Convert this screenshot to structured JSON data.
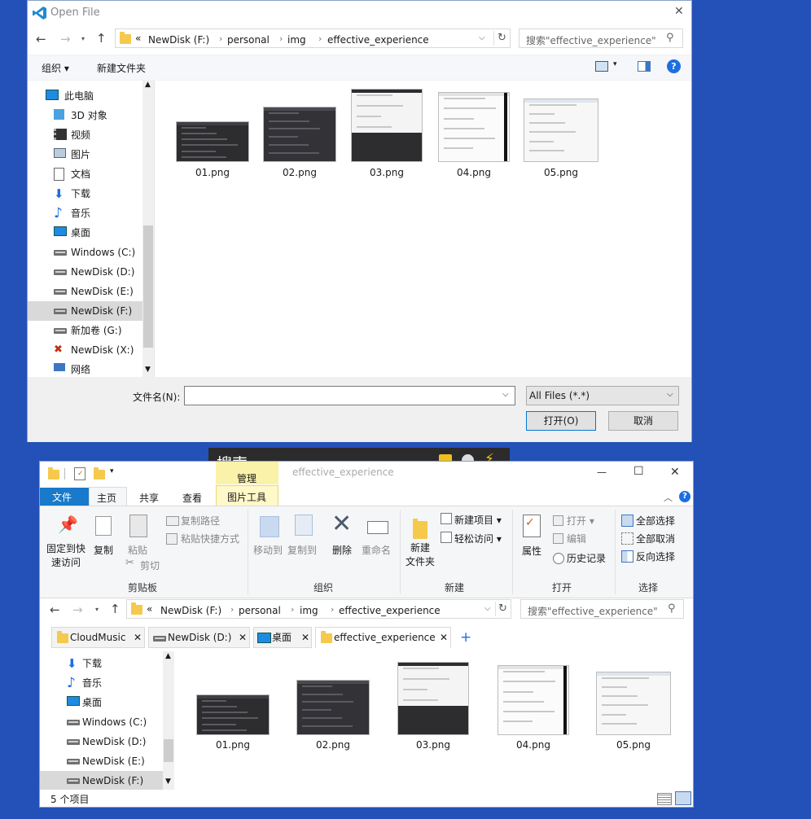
{
  "dialog": {
    "title": "Open File",
    "close_glyph": "✕",
    "path": {
      "overflow": "«",
      "segments": [
        "NewDisk (F:)",
        "personal",
        "img",
        "effective_experience"
      ]
    },
    "search_placeholder": "搜索\"effective_experience\"",
    "toolbar": {
      "organize": "组织 ▾",
      "new_folder": "新建文件夹",
      "help": "?"
    },
    "nav": [
      {
        "label": "此电脑",
        "icon": "computer-icon"
      },
      {
        "label": "3D 对象",
        "icon": "cube-icon"
      },
      {
        "label": "视频",
        "icon": "video-icon"
      },
      {
        "label": "图片",
        "icon": "picture-icon"
      },
      {
        "label": "文档",
        "icon": "document-icon"
      },
      {
        "label": "下载",
        "icon": "download-icon"
      },
      {
        "label": "音乐",
        "icon": "music-icon"
      },
      {
        "label": "桌面",
        "icon": "desktop-icon"
      },
      {
        "label": "Windows (C:)",
        "icon": "drive-icon"
      },
      {
        "label": "NewDisk (D:)",
        "icon": "drive-icon"
      },
      {
        "label": "NewDisk (E:)",
        "icon": "drive-icon"
      },
      {
        "label": "NewDisk (F:)",
        "icon": "drive-icon",
        "selected": true
      },
      {
        "label": "新加卷 (G:)",
        "icon": "drive-icon"
      },
      {
        "label": "NewDisk (X:)",
        "icon": "network-drive-error-icon"
      },
      {
        "label": "网络",
        "icon": "network-icon"
      }
    ],
    "files": [
      "01.png",
      "02.png",
      "03.png",
      "04.png",
      "05.png"
    ],
    "filename_label": "文件名(N):",
    "filename_value": "",
    "filter": "All Files (*.*)",
    "open_button": "打开(O)",
    "cancel_button": "取消"
  },
  "overlay": {
    "label": "搜索",
    "accent": "#f0c020"
  },
  "explorer": {
    "qat_title": "effective_experience",
    "context_tab": "管理",
    "ribbon_tabs": [
      "文件",
      "主页",
      "共享",
      "查看",
      "图片工具"
    ],
    "window_controls": {
      "min": "—",
      "max": "☐",
      "close": "✕"
    },
    "clipboard": {
      "pin": "固定到快\n速访问",
      "copy": "复制",
      "paste": "粘贴",
      "copy_path": "复制路径",
      "paste_shortcut": "粘贴快捷方式",
      "cut": "剪切",
      "group": "剪贴板"
    },
    "organize": {
      "move_to": "移动到",
      "copy_to": "复制到",
      "delete": "删除",
      "rename": "重命名",
      "group": "组织"
    },
    "new": {
      "new_folder": "新建\n文件夹",
      "new_item": "新建项目 ▾",
      "easy_access": "轻松访问 ▾",
      "group": "新建"
    },
    "open": {
      "properties": "属性",
      "open": "打开 ▾",
      "edit": "编辑",
      "history": "历史记录",
      "group": "打开"
    },
    "select": {
      "all": "全部选择",
      "none": "全部取消",
      "invert": "反向选择",
      "group": "选择"
    },
    "path": {
      "overflow": "«",
      "segments": [
        "NewDisk (F:)",
        "personal",
        "img",
        "effective_experience"
      ]
    },
    "search_placeholder": "搜索\"effective_experience\"",
    "tabs": [
      "CloudMusic",
      "NewDisk (D:)",
      "桌面",
      "effective_experience"
    ],
    "add_tab": "+",
    "nav": [
      {
        "label": "下载",
        "icon": "download-icon"
      },
      {
        "label": "音乐",
        "icon": "music-icon"
      },
      {
        "label": "桌面",
        "icon": "desktop-icon"
      },
      {
        "label": "Windows (C:)",
        "icon": "drive-icon"
      },
      {
        "label": "NewDisk (D:)",
        "icon": "drive-icon"
      },
      {
        "label": "NewDisk (E:)",
        "icon": "drive-icon"
      },
      {
        "label": "NewDisk (F:)",
        "icon": "drive-icon",
        "selected": true
      }
    ],
    "files": [
      "01.png",
      "02.png",
      "03.png",
      "04.png",
      "05.png"
    ],
    "status": "5 个项目"
  }
}
